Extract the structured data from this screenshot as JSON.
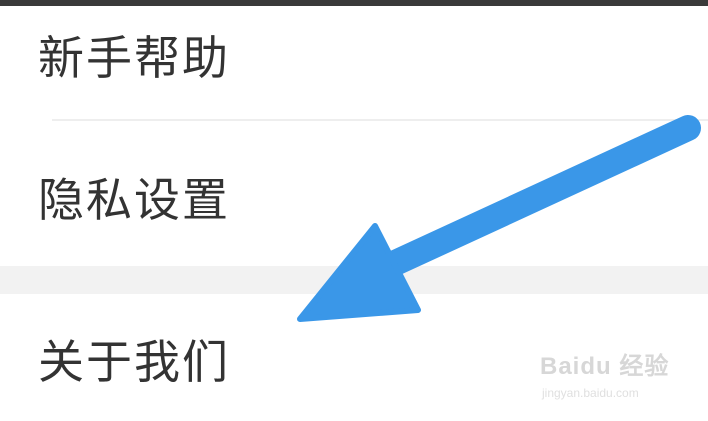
{
  "menu": {
    "items": [
      {
        "label": "新手帮助"
      },
      {
        "label": "隐私设置"
      },
      {
        "label": "关于我们"
      }
    ]
  },
  "annotation": {
    "arrow_color": "#3a97e8"
  },
  "watermark": {
    "brand": "Baidu 经验",
    "url": "jingyan.baidu.com"
  }
}
